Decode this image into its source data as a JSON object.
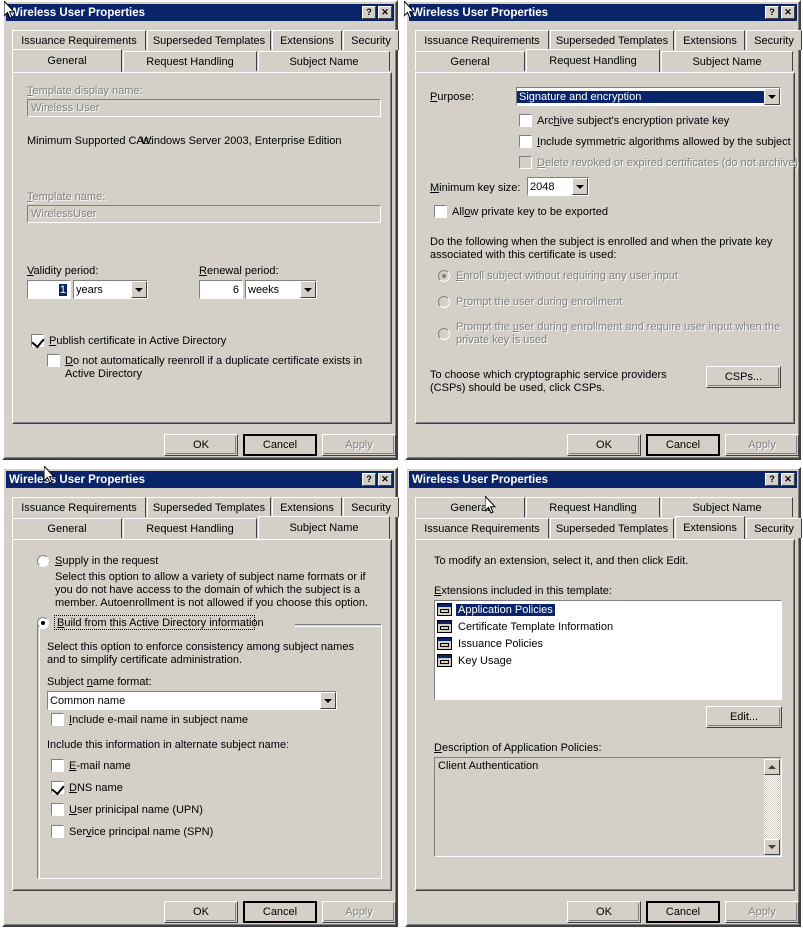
{
  "window": {
    "title": "Wireless User Properties",
    "help_button": "?",
    "close_button": "✕"
  },
  "tabs": {
    "issuance_requirements": "Issuance Requirements",
    "superseded_templates": "Superseded Templates",
    "extensions": "Extensions",
    "security": "Security",
    "general": "General",
    "request_handling": "Request Handling",
    "subject_name": "Subject Name"
  },
  "buttons": {
    "ok": "OK",
    "cancel": "Cancel",
    "apply": "Apply",
    "csps": "CSPs...",
    "edit": "Edit..."
  },
  "general_tab": {
    "display_name_label": "Template display name:",
    "display_name_value": "Wireless User",
    "min_ca_label": "Minimum Supported CAs:",
    "min_ca_value": "Windows Server 2003, Enterprise Edition",
    "template_name_label": "Template name:",
    "template_name_value": "WirelessUser",
    "validity_label": "Validity period:",
    "validity_value": "1",
    "validity_unit": "years",
    "renewal_label": "Renewal period:",
    "renewal_value": "6",
    "renewal_unit": "weeks",
    "publish_label": "Publish certificate in Active Directory",
    "publish_checked": true,
    "no_reenroll_label": "Do not automatically reenroll if a duplicate certificate exists in Active Directory",
    "no_reenroll_checked": false
  },
  "request_handling_tab": {
    "purpose_label": "Purpose:",
    "purpose_value": "Signature and encryption",
    "archive_label": "Archive subject's encryption private key",
    "archive_checked": false,
    "symmetric_label": "Include symmetric algorithms allowed by the subject",
    "symmetric_checked": false,
    "delete_revoked_label": "Delete revoked or expired certificates (do not archive)",
    "delete_revoked_checked": false,
    "min_key_size_label": "Minimum key size:",
    "min_key_size_value": "2048",
    "allow_export_label": "Allow private key to be exported",
    "allow_export_checked": false,
    "do_following_label": "Do the following when the subject is enrolled and when the private key associated with this certificate is used:",
    "radio_enroll_no_input": "Enroll subject without requiring any user input",
    "radio_prompt_enrollment": "Prompt the user during enrollment",
    "radio_prompt_and_key": "Prompt the user during enrollment and require user input when the private key is used",
    "radio_selected": "enroll_no_input",
    "csp_help_text": "To choose which cryptographic service providers (CSPs) should be used, click CSPs."
  },
  "subject_name_tab": {
    "supply_request_label": "Supply in the request",
    "supply_request_desc": "Select this option to allow a variety of subject name formats or if you do not have access to the domain of which the subject is a member. Autoenrollment is not allowed if you choose this option.",
    "build_ad_label": "Build from this Active Directory information",
    "build_ad_desc": "Select this option to enforce consistency among subject names and to simplify certificate administration.",
    "radio_selected": "build_ad",
    "subject_name_format_label": "Subject name format:",
    "subject_name_format_value": "Common name",
    "include_email_label": "Include e-mail name in subject name",
    "include_email_checked": false,
    "alt_subject_label": "Include this information in alternate subject name:",
    "alt_options": [
      {
        "label": "E-mail name",
        "checked": false
      },
      {
        "label": "DNS name",
        "checked": true
      },
      {
        "label": "User prinicipal name (UPN)",
        "checked": false
      },
      {
        "label": "Service principal name (SPN)",
        "checked": false
      }
    ]
  },
  "extensions_tab": {
    "modify_hint": "To modify an extension, select it, and then click Edit.",
    "extensions_list_label": "Extensions included in this template:",
    "extensions": [
      {
        "label": "Application Policies",
        "selected": true
      },
      {
        "label": "Certificate Template Information",
        "selected": false
      },
      {
        "label": "Issuance Policies",
        "selected": false
      },
      {
        "label": "Key Usage",
        "selected": false
      }
    ],
    "description_label": "Description of Application Policies:",
    "description_value": "Client Authentication"
  },
  "colors": {
    "titlebar": "#0a246a",
    "dialog_face": "#d4d0c8",
    "highlight": "#0a246a",
    "disabled_text": "#808080"
  }
}
